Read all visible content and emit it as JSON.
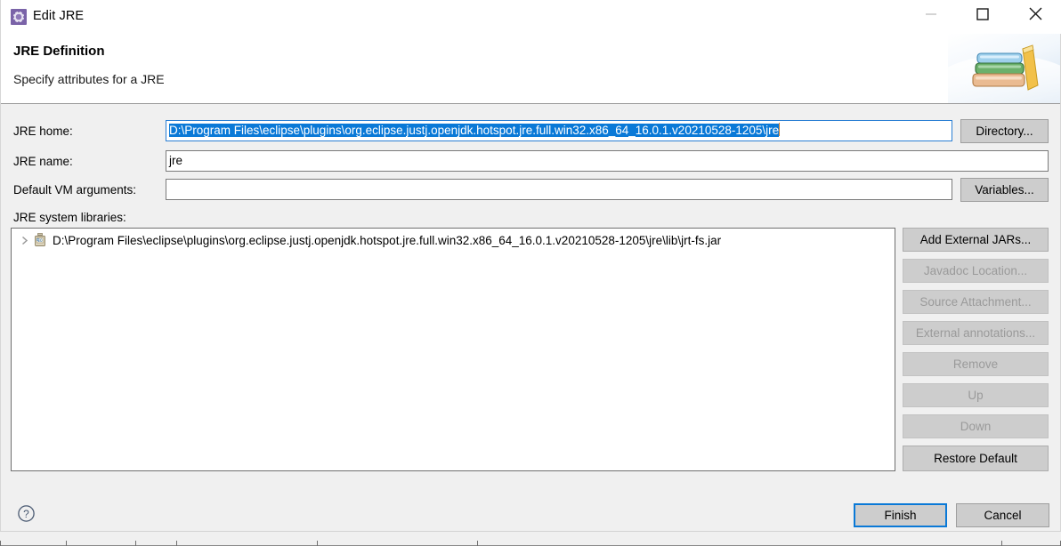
{
  "window": {
    "title": "Edit JRE",
    "icon": "jre-gear-icon",
    "controls": {
      "minimize": "minimize-icon",
      "maximize": "maximize-icon",
      "close": "close-icon"
    }
  },
  "header": {
    "title": "JRE Definition",
    "subtitle": "Specify attributes for a JRE",
    "art_icon": "books-stack-icon"
  },
  "form": {
    "jre_home": {
      "label": "JRE home:",
      "value": "D:\\Program Files\\eclipse\\plugins\\org.eclipse.justj.openjdk.hotspot.jre.full.win32.x86_64_16.0.1.v20210528-1205\\jre",
      "placeholder": "",
      "selected": true,
      "focused": true,
      "button": "Directory..."
    },
    "jre_name": {
      "label": "JRE name:",
      "value": "jre",
      "placeholder": ""
    },
    "vm_args": {
      "label": "Default VM arguments:",
      "value": "",
      "placeholder": "",
      "button": "Variables..."
    },
    "system_libraries": {
      "label": "JRE system libraries:",
      "tree": [
        {
          "icon": "jar-icon",
          "expander": "chevron-right-icon",
          "label": "D:\\Program Files\\eclipse\\plugins\\org.eclipse.justj.openjdk.hotspot.jre.full.win32.x86_64_16.0.1.v20210528-1205\\jre\\lib\\jrt-fs.jar",
          "expanded": false
        }
      ]
    }
  },
  "side_buttons": [
    {
      "label": "Add External JARs...",
      "enabled": true
    },
    {
      "label": "Javadoc Location...",
      "enabled": false
    },
    {
      "label": "Source Attachment...",
      "enabled": false
    },
    {
      "label": "External annotations...",
      "enabled": false
    },
    {
      "label": "Remove",
      "enabled": false
    },
    {
      "label": "Up",
      "enabled": false
    },
    {
      "label": "Down",
      "enabled": false
    },
    {
      "label": "Restore Default",
      "enabled": true
    }
  ],
  "footer": {
    "help_icon": "help-question-icon",
    "finish": "Finish",
    "cancel": "Cancel",
    "default_button": "Finish"
  },
  "colors": {
    "selection_blue": "#0a79d7",
    "focus_blue": "#2a7fd4",
    "dialog_gray": "#f0f0f0",
    "button_gray": "#cdcdcd",
    "disabled_text": "#9a9a9a"
  }
}
